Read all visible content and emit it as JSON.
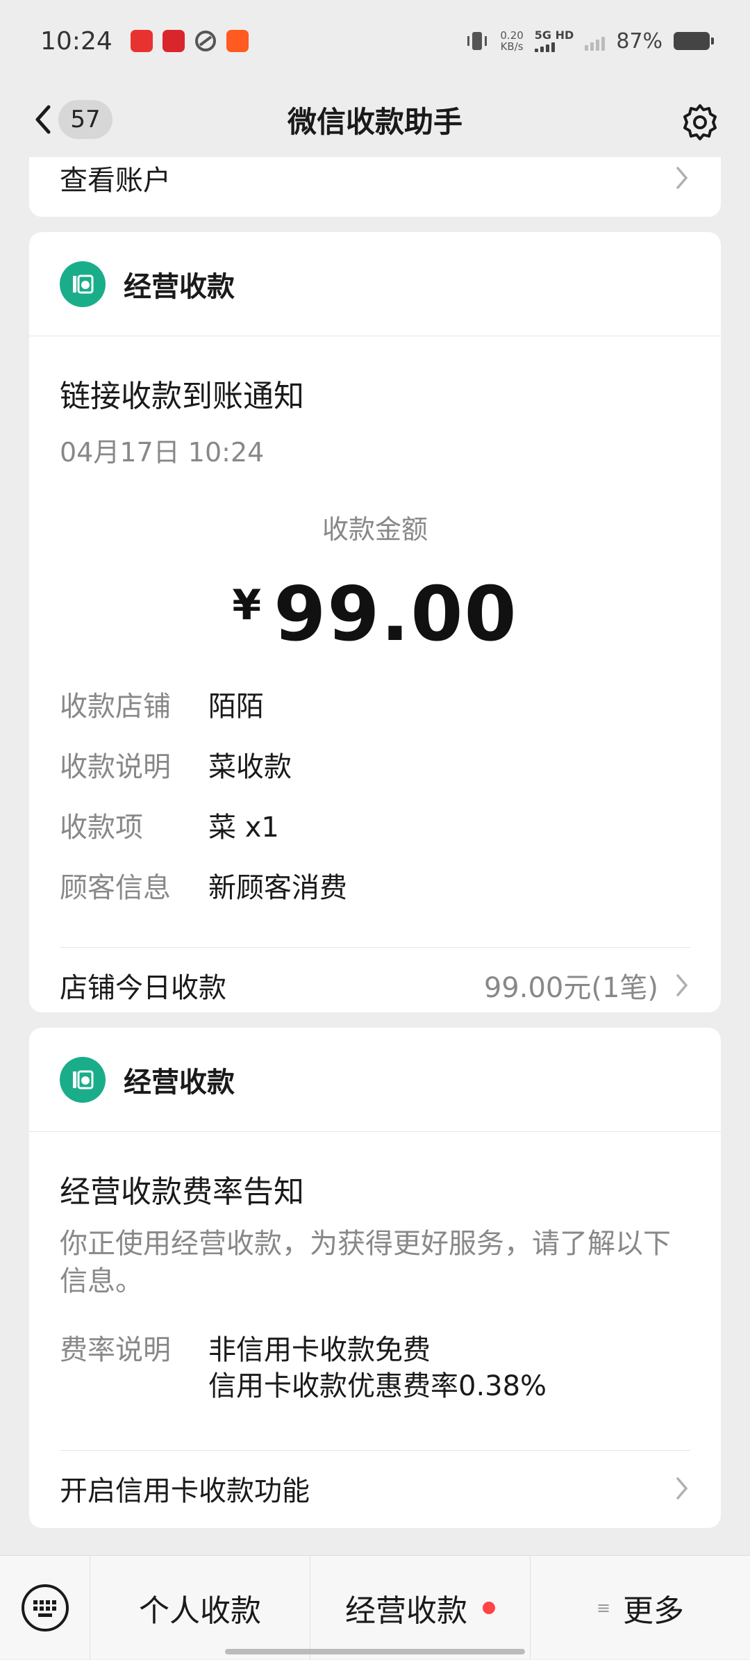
{
  "status_bar": {
    "time": "10:24",
    "net_speed_value": "0.20",
    "net_speed_unit": "KB/s",
    "net_type": "5G HD",
    "battery": "87%"
  },
  "nav": {
    "unread_count": "57",
    "title": "微信收款助手"
  },
  "account_card": {
    "link_label": "查看账户"
  },
  "payment_card": {
    "header_title": "经营收款",
    "notice_title": "链接收款到账通知",
    "notice_time": "04月17日 10:24",
    "amount_label": "收款金额",
    "currency": "¥",
    "amount": "99.00",
    "fields": [
      {
        "key": "收款店铺",
        "value": "陌陌"
      },
      {
        "key": "收款说明",
        "value": "菜收款"
      },
      {
        "key": "收款项",
        "value": "菜 x1"
      },
      {
        "key": "顾客信息",
        "value": "新顾客消费"
      }
    ],
    "today_label": "店铺今日收款",
    "today_value": "99.00元(1笔)"
  },
  "fee_card": {
    "header_title": "经营收款",
    "title": "经营收款费率告知",
    "description": "你正使用经营收款，为获得更好服务，请了解以下信息。",
    "fee_key": "费率说明",
    "fee_line1": "非信用卡收款免费",
    "fee_line2": "信用卡收款优惠费率0.38%",
    "credit_link": "开启信用卡收款功能"
  },
  "bottom_menu": {
    "item1": "个人收款",
    "item2": "经营收款",
    "item3": "更多"
  },
  "colors": {
    "brand_green": "#1aad8a",
    "dot_red": "#ff4444"
  }
}
